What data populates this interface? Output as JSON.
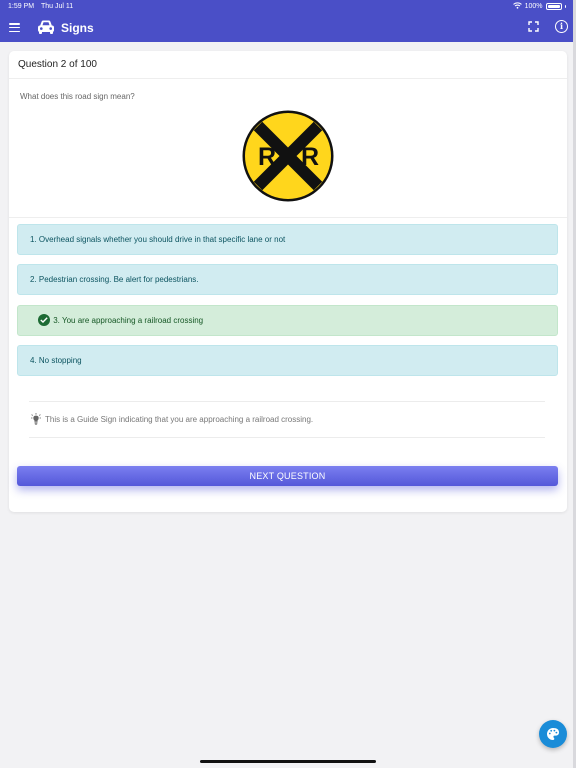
{
  "status_bar": {
    "time": "1:59 PM",
    "date": "Thu Jul 11",
    "battery": "100%"
  },
  "app_bar": {
    "title": "Signs",
    "color": "#4a4fc7"
  },
  "question": {
    "header": "Question 2 of 100",
    "text": "What does this road sign mean?",
    "sign_letters": [
      "R",
      "R"
    ]
  },
  "answers": [
    {
      "label": "1. Overhead signals whether you should drive in that specific lane or not",
      "state": "neutral"
    },
    {
      "label": "2. Pedestrian crossing. Be alert for pedestrians.",
      "state": "neutral"
    },
    {
      "label": "3. You are approaching a railroad crossing",
      "state": "correct"
    },
    {
      "label": "4. No stopping",
      "state": "neutral"
    }
  ],
  "hint": {
    "text": "This is a Guide Sign indicating that you are approaching a railroad crossing."
  },
  "next_button": {
    "label": "NEXT QUESTION"
  },
  "icons": {
    "menu": "hamburger-icon",
    "logo": "car-icon",
    "fullscreen": "fullscreen-icon",
    "info": "info-icon",
    "hint": "lightbulb-icon",
    "theme": "palette-icon",
    "correct": "checkmark-icon"
  },
  "colors": {
    "accent": "#4a4fc7",
    "answer_bg": "#d1ecf1",
    "correct_bg": "#d4edda",
    "sign_yellow": "#ffd61c",
    "fab": "#1a8cd8"
  }
}
